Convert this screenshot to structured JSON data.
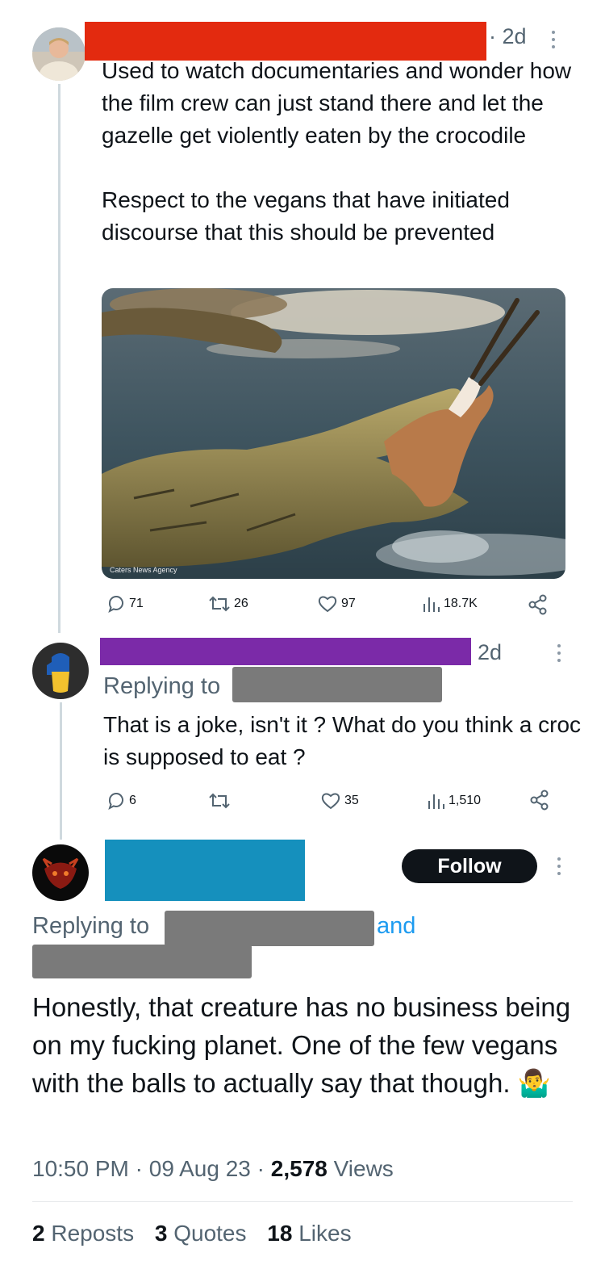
{
  "tweet1": {
    "time": "· 2d",
    "text": "Used to watch documentaries and wonder how the film crew can just stand there and let the gazelle get violently eaten by the crocodile\n\nRespect to the vegans that have initiated discourse that this should be prevented",
    "image_credit": "Caters News Agency",
    "replies": "71",
    "reposts": "26",
    "likes": "97",
    "views": "18.7K",
    "name_redaction_color": "#e32a0f"
  },
  "tweet2": {
    "time": "2d",
    "replying_to": "Replying to",
    "text": "That is a joke, isn't it ? What do you think a croc is supposed to eat ?",
    "replies": "6",
    "likes": "35",
    "views": "1,510",
    "name_redaction_color": "#7b2aa8"
  },
  "tweet3": {
    "follow_label": "Follow",
    "replying_to": "Replying to",
    "and": "and",
    "text": "Honestly, that creature has no business being on my fucking planet. One of the few vegans with the balls to actually say that though. 🤷‍♂️",
    "time": "10:50 PM",
    "date": "09 Aug 23",
    "views_count": "2,578",
    "views_label": "Views",
    "reposts_count": "2",
    "reposts_label": "Reposts",
    "quotes_count": "3",
    "quotes_label": "Quotes",
    "likes_count": "18",
    "likes_label": "Likes",
    "name_redaction_color": "#1590bd",
    "mention_color": "#1d9bf0"
  },
  "icons": [
    "reply-icon",
    "repost-icon",
    "like-icon",
    "views-icon",
    "share-icon",
    "more-icon"
  ]
}
